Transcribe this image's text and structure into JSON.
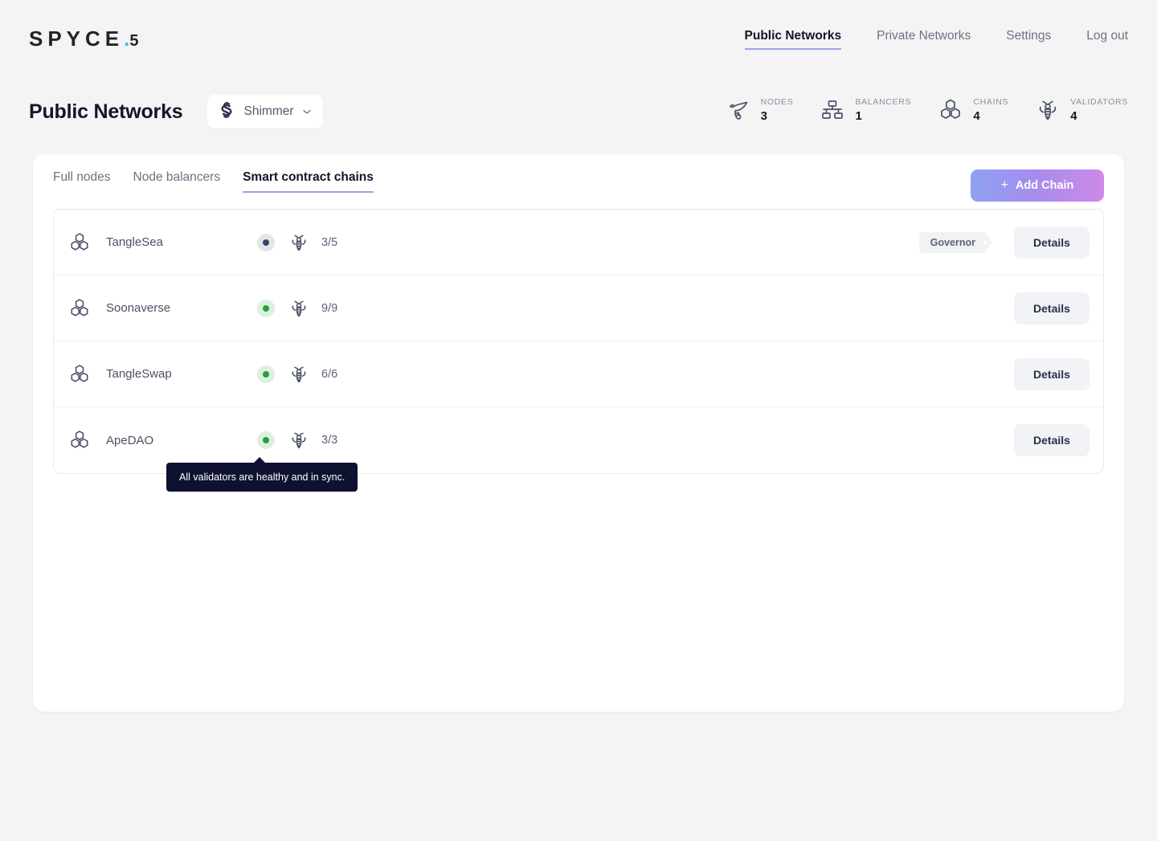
{
  "brand": {
    "word": "SPYCE",
    "dot": ".",
    "five": "5",
    "accent": "#29c7d6"
  },
  "nav": {
    "items": [
      {
        "label": "Public Networks",
        "active": true
      },
      {
        "label": "Private Networks",
        "active": false
      },
      {
        "label": "Settings",
        "active": false
      },
      {
        "label": "Log out",
        "active": false
      }
    ]
  },
  "header": {
    "title": "Public Networks",
    "network_selector": {
      "value": "Shimmer",
      "icon": "shimmer-logo-icon",
      "chevron": "chevron-down-icon"
    }
  },
  "stats": [
    {
      "label": "NODES",
      "value": "3",
      "icon": "wasp-icon"
    },
    {
      "label": "BALANCERS",
      "value": "1",
      "icon": "network-tree-icon"
    },
    {
      "label": "CHAINS",
      "value": "4",
      "icon": "hexagon-cluster-icon"
    },
    {
      "label": "VALIDATORS",
      "value": "4",
      "icon": "bee-icon"
    }
  ],
  "tabs": [
    {
      "label": "Full nodes",
      "active": false
    },
    {
      "label": "Node balancers",
      "active": false
    },
    {
      "label": "Smart contract chains",
      "active": true
    }
  ],
  "toolbar": {
    "add_chain_label": "Add Chain",
    "add_chain_plus": "+"
  },
  "chains": [
    {
      "name": "TangleSea",
      "icon": "hexagon-cluster-icon",
      "status": "grey",
      "validators": "3/5",
      "badge": "Governor",
      "details_label": "Details"
    },
    {
      "name": "Soonaverse",
      "icon": "hexagon-cluster-icon",
      "status": "green",
      "validators": "9/9",
      "badge": "",
      "details_label": "Details"
    },
    {
      "name": "TangleSwap",
      "icon": "hexagon-cluster-icon",
      "status": "green",
      "validators": "6/6",
      "badge": "",
      "details_label": "Details"
    },
    {
      "name": "ApeDAO",
      "icon": "hexagon-cluster-icon",
      "status": "green",
      "validators": "3/3",
      "badge": "",
      "details_label": "Details"
    }
  ],
  "tooltip": {
    "text": "All validators are healthy and in sync.",
    "background": "#0e1230"
  },
  "colors": {
    "page_background": "#f4f4f5",
    "accent_purple": "#9aa3e8",
    "status_healthy": "#2a9d3d",
    "status_degraded": "#3b4468",
    "text_dark": "#14142b"
  }
}
